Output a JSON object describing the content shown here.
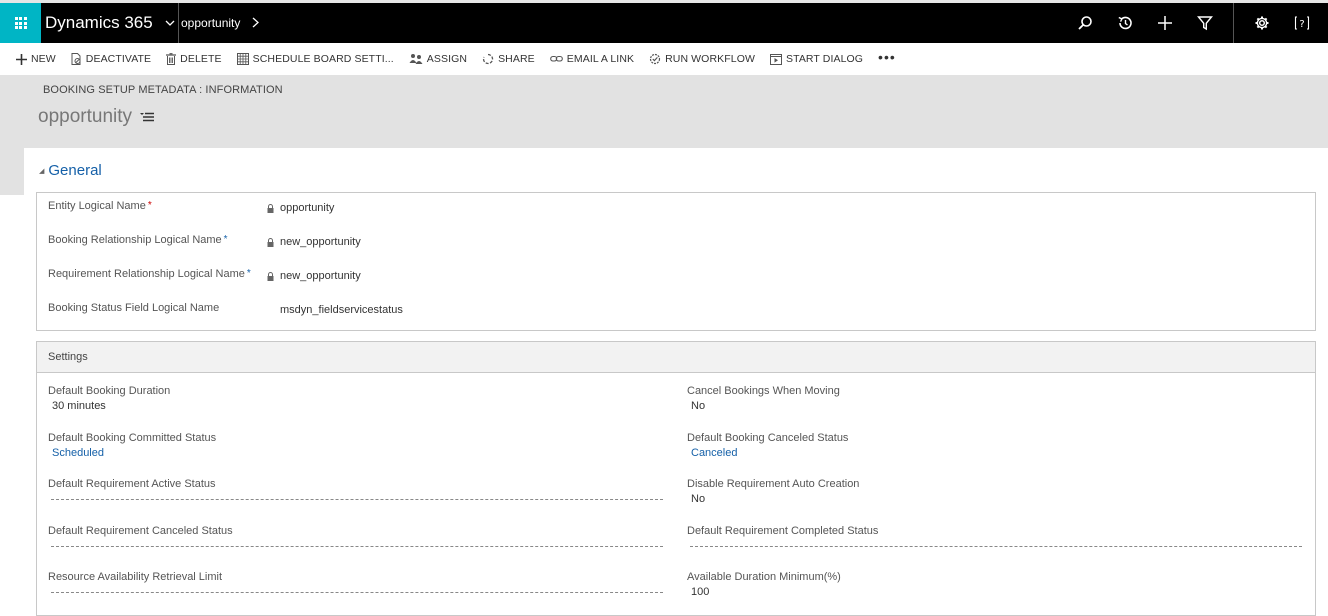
{
  "topbar": {
    "app_name": "Dynamics 365",
    "breadcrumb": "opportunity",
    "icons": [
      "search-icon",
      "recent-history-icon",
      "quick-create-plus-icon",
      "advanced-find-filter-icon",
      "settings-gear-icon",
      "help-icon"
    ]
  },
  "commandbar": {
    "items": [
      {
        "label": "NEW",
        "icon": "plus-icon"
      },
      {
        "label": "DEACTIVATE",
        "icon": "deactivate-icon"
      },
      {
        "label": "DELETE",
        "icon": "trash-icon"
      },
      {
        "label": "SCHEDULE BOARD SETTI...",
        "icon": "grid-icon"
      },
      {
        "label": "ASSIGN",
        "icon": "assign-icon"
      },
      {
        "label": "SHARE",
        "icon": "share-icon"
      },
      {
        "label": "EMAIL A LINK",
        "icon": "link-icon"
      },
      {
        "label": "RUN WORKFLOW",
        "icon": "workflow-icon"
      },
      {
        "label": "START DIALOG",
        "icon": "dialog-icon"
      }
    ],
    "more_label": "•••"
  },
  "header": {
    "entity_type": "BOOKING SETUP METADATA : INFORMATION",
    "record_title": "opportunity"
  },
  "general": {
    "section_label": "General",
    "fields": [
      {
        "label": "Entity Logical Name",
        "required": "*",
        "required_type": "business-required",
        "value": "opportunity",
        "locked": true
      },
      {
        "label": "Booking Relationship Logical Name",
        "required": "*",
        "required_type": "business-recommended",
        "value": "new_opportunity",
        "locked": true
      },
      {
        "label": "Requirement Relationship Logical Name",
        "required": "*",
        "required_type": "business-recommended",
        "value": "new_opportunity",
        "locked": true
      },
      {
        "label": "Booking Status Field Logical Name",
        "required": "",
        "value": "msdyn_fieldservicestatus",
        "locked": false
      }
    ]
  },
  "settings": {
    "section_label": "Settings",
    "left": [
      {
        "label": "Default Booking Duration",
        "value": "30 minutes",
        "type": "text"
      },
      {
        "label": "Default Booking Committed Status",
        "value": "Scheduled",
        "type": "lookup"
      },
      {
        "label": "Default Requirement Active Status",
        "value": "",
        "type": "empty"
      },
      {
        "label": "Default Requirement Canceled Status",
        "value": "",
        "type": "empty"
      },
      {
        "label": "Resource Availability Retrieval Limit",
        "value": "",
        "type": "empty"
      }
    ],
    "right": [
      {
        "label": "Cancel Bookings When Moving",
        "value": "No",
        "type": "text"
      },
      {
        "label": "Default Booking Canceled Status",
        "value": "Canceled",
        "type": "lookup"
      },
      {
        "label": "Disable Requirement Auto Creation",
        "value": "No",
        "type": "text"
      },
      {
        "label": "Default Requirement Completed Status",
        "value": "",
        "type": "empty"
      },
      {
        "label": "Available Duration Minimum(%)",
        "value": "100",
        "type": "text"
      }
    ]
  },
  "colors": {
    "waffle_bg": "#00b5c5",
    "topbar_bg": "#000000",
    "header_bg": "#e2e2e2",
    "link": "#1560a8",
    "required_red": "#cc0000"
  }
}
